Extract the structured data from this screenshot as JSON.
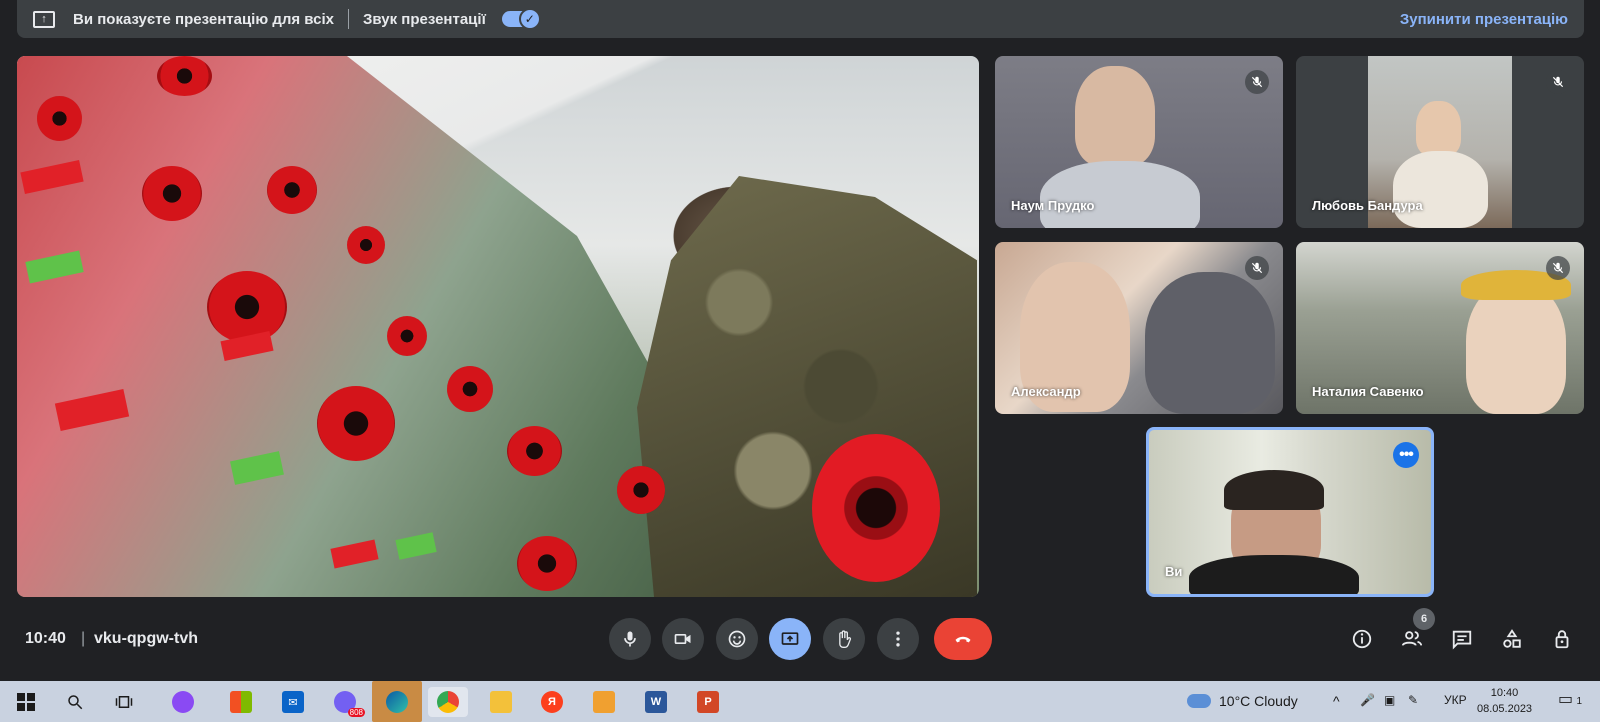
{
  "presenting_bar": {
    "message": "Ви показуєте презентацію для всіх",
    "audio_label": "Звук презентації",
    "audio_enabled": true,
    "stop_label": "Зупинити презентацію"
  },
  "participants": [
    {
      "name": "Наум Прудко",
      "muted": true
    },
    {
      "name": "Любовь Бандура",
      "muted": true
    },
    {
      "name": "Александр",
      "muted": true
    },
    {
      "name": "Наталия Савенко",
      "muted": true
    },
    {
      "name": "Ви",
      "muted": false
    }
  ],
  "meeting": {
    "time": "10:40",
    "code": "vku-qpgw-tvh",
    "people_count": "6"
  },
  "controls": {
    "mic_icon": "microphone-icon",
    "camera_icon": "camera-icon",
    "reactions_icon": "emoji-icon",
    "present_icon": "present-screen-icon",
    "hand_icon": "raise-hand-icon",
    "more_icon": "more-options-icon",
    "end_icon": "hang-up-icon"
  },
  "taskbar": {
    "viber_badge": "808",
    "weather": "10°C  Cloudy",
    "language": "УКР",
    "clock_time": "10:40",
    "clock_date": "08.05.2023",
    "notification_count": "1"
  },
  "colors": {
    "accent": "#8ab4f8",
    "end_call": "#ea4335",
    "background": "#202124"
  }
}
